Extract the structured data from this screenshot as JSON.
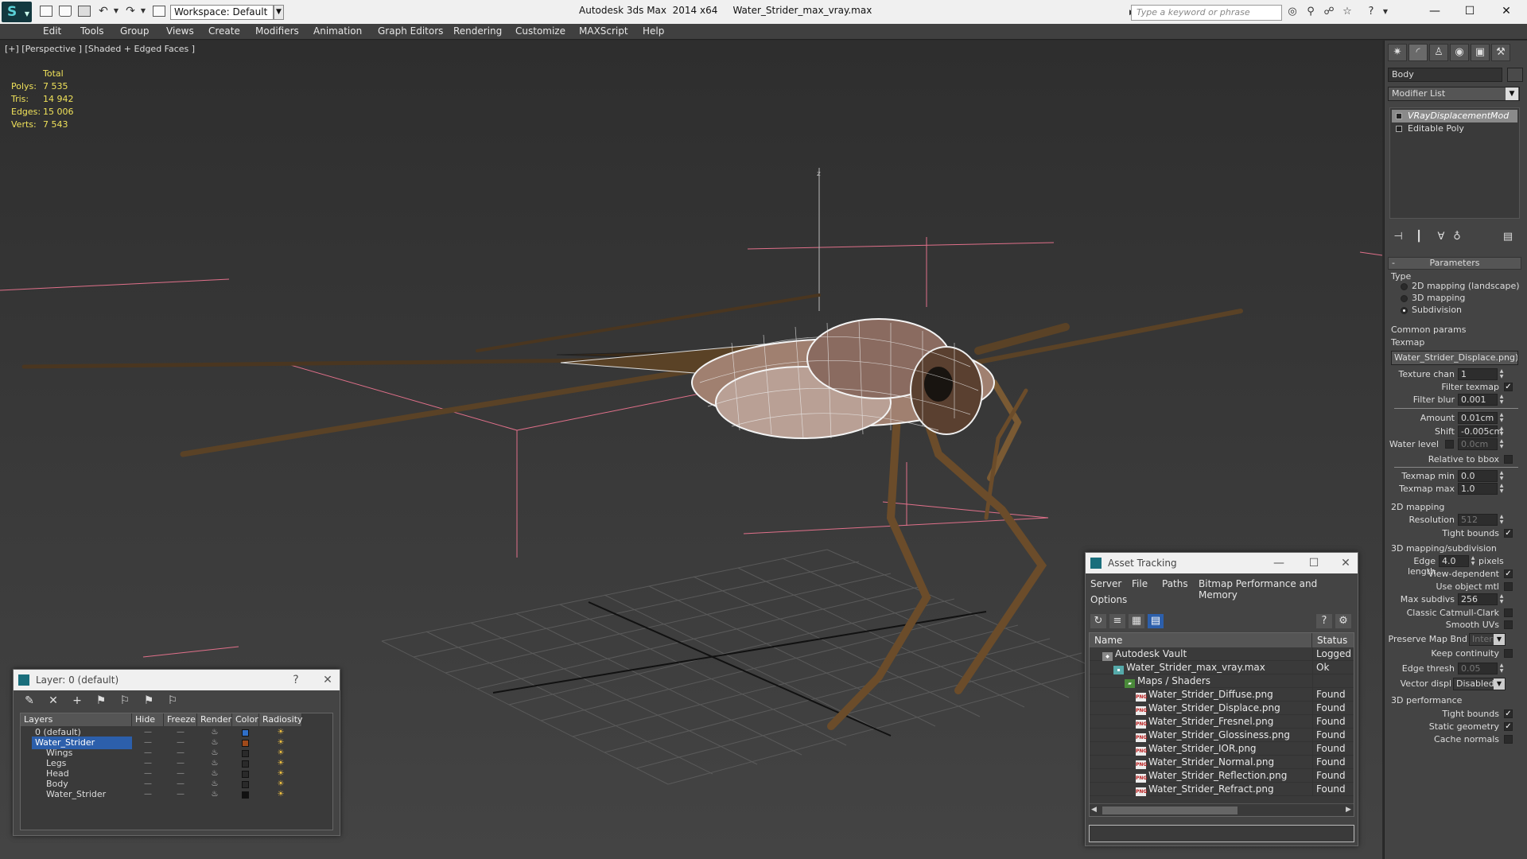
{
  "titlebar": {
    "app_title": "Autodesk 3ds Max  2014 x64",
    "file_name": "Water_Strider_max_vray.max",
    "workspace": "Workspace: Default",
    "search_placeholder": "Type a keyword or phrase"
  },
  "menu": [
    "Edit",
    "Tools",
    "Group",
    "Views",
    "Create",
    "Modifiers",
    "Animation",
    "Graph Editors",
    "Rendering",
    "Customize",
    "MAXScript",
    "Help"
  ],
  "viewport": {
    "label": "[+] [Perspective ] [Shaded + Edged Faces ]",
    "stats_header": "Total",
    "stats": [
      {
        "label": "Polys:",
        "value": "7 535"
      },
      {
        "label": "Tris:",
        "value": "14 942"
      },
      {
        "label": "Edges:",
        "value": "15 006"
      },
      {
        "label": "Verts:",
        "value": "7 543"
      }
    ],
    "axis_label": "z"
  },
  "command_panel": {
    "object_name": "Body",
    "modifier_list": "Modifier List",
    "stack": [
      "VRayDisplacementMod",
      "Editable Poly"
    ],
    "parameters_title": "Parameters",
    "type_group": "Type",
    "type_options": [
      "2D mapping (landscape)",
      "3D mapping",
      "Subdivision"
    ],
    "common_group": "Common params",
    "texmap_label": "Texmap",
    "texmap_value": "Water_Strider_Displace.png)",
    "texture_chan_label": "Texture chan",
    "texture_chan_value": "1",
    "filter_texmap_label": "Filter texmap",
    "filter_blur_label": "Filter blur",
    "filter_blur_value": "0.001",
    "amount_label": "Amount",
    "amount_value": "0.01cm",
    "shift_label": "Shift",
    "shift_value": "-0.005cm",
    "water_level_label": "Water level",
    "water_level_value": "0.0cm",
    "relative_bbox_label": "Relative to bbox",
    "texmap_min_label": "Texmap min",
    "texmap_min_value": "0.0",
    "texmap_max_label": "Texmap max",
    "texmap_max_value": "1.0",
    "mapping2d_group": "2D mapping",
    "resolution_label": "Resolution",
    "resolution_value": "512",
    "tight_bounds_label": "Tight bounds",
    "mapping3d_group": "3D mapping/subdivision",
    "edge_length_label": "Edge length",
    "edge_length_value": "4.0",
    "pixels_label": "pixels",
    "view_dependent_label": "View-dependent",
    "use_object_mtl_label": "Use object mtl",
    "max_subdivs_label": "Max subdivs",
    "max_subdivs_value": "256",
    "classic_catmull_label": "Classic Catmull-Clark",
    "smooth_uvs_label": "Smooth UVs",
    "preserve_map_label": "Preserve Map Bnd",
    "preserve_map_value": "Interr",
    "keep_continuity_label": "Keep continuity",
    "edge_thresh_label": "Edge thresh",
    "edge_thresh_value": "0.05",
    "vector_displ_label": "Vector displ",
    "vector_displ_value": "Disabled",
    "perf_group": "3D performance",
    "perf_tight_bounds_label": "Tight bounds",
    "static_geometry_label": "Static geometry",
    "cache_normals_label": "Cache normals"
  },
  "layer_window": {
    "title": "Layer: 0 (default)",
    "help": "?",
    "columns": [
      "Layers",
      "Hide",
      "Freeze",
      "Render",
      "Color",
      "Radiosity"
    ],
    "rows": [
      {
        "name": "0 (default)",
        "indent": 0,
        "color": "#2f6fc8",
        "selected": false
      },
      {
        "name": "Water_Strider",
        "indent": 0,
        "color": "#a04a1a",
        "selected": true
      },
      {
        "name": "Wings",
        "indent": 1,
        "color": "#2a2a2a",
        "selected": false
      },
      {
        "name": "Legs",
        "indent": 1,
        "color": "#2a2a2a",
        "selected": false
      },
      {
        "name": "Head",
        "indent": 1,
        "color": "#2a2a2a",
        "selected": false
      },
      {
        "name": "Body",
        "indent": 1,
        "color": "#2a2a2a",
        "selected": false
      },
      {
        "name": "Water_Strider",
        "indent": 1,
        "color": "#111111",
        "selected": false
      }
    ]
  },
  "asset_window": {
    "title": "Asset Tracking",
    "menus": [
      "Server",
      "File",
      "Paths",
      "Bitmap Performance and Memory",
      "Options"
    ],
    "columns": [
      "Name",
      "Status"
    ],
    "rows": [
      {
        "name": "Autodesk Vault",
        "status": "Logged O",
        "indent": 0,
        "kind": "vault"
      },
      {
        "name": "Water_Strider_max_vray.max",
        "status": "Ok",
        "indent": 1,
        "kind": "max"
      },
      {
        "name": "Maps / Shaders",
        "status": "",
        "indent": 2,
        "kind": "folder"
      },
      {
        "name": "Water_Strider_Diffuse.png",
        "status": "Found",
        "indent": 3,
        "kind": "png"
      },
      {
        "name": "Water_Strider_Displace.png",
        "status": "Found",
        "indent": 3,
        "kind": "png"
      },
      {
        "name": "Water_Strider_Fresnel.png",
        "status": "Found",
        "indent": 3,
        "kind": "png"
      },
      {
        "name": "Water_Strider_Glossiness.png",
        "status": "Found",
        "indent": 3,
        "kind": "png"
      },
      {
        "name": "Water_Strider_IOR.png",
        "status": "Found",
        "indent": 3,
        "kind": "png"
      },
      {
        "name": "Water_Strider_Normal.png",
        "status": "Found",
        "indent": 3,
        "kind": "png"
      },
      {
        "name": "Water_Strider_Reflection.png",
        "status": "Found",
        "indent": 3,
        "kind": "png"
      },
      {
        "name": "Water_Strider_Refract.png",
        "status": "Found",
        "indent": 3,
        "kind": "png"
      }
    ]
  },
  "colors": {
    "viewport_stats": "#f0e25a",
    "selection_blue": "#2c5fab",
    "bounding_box": "#e0708a",
    "model_brown": "#7a5a33"
  }
}
